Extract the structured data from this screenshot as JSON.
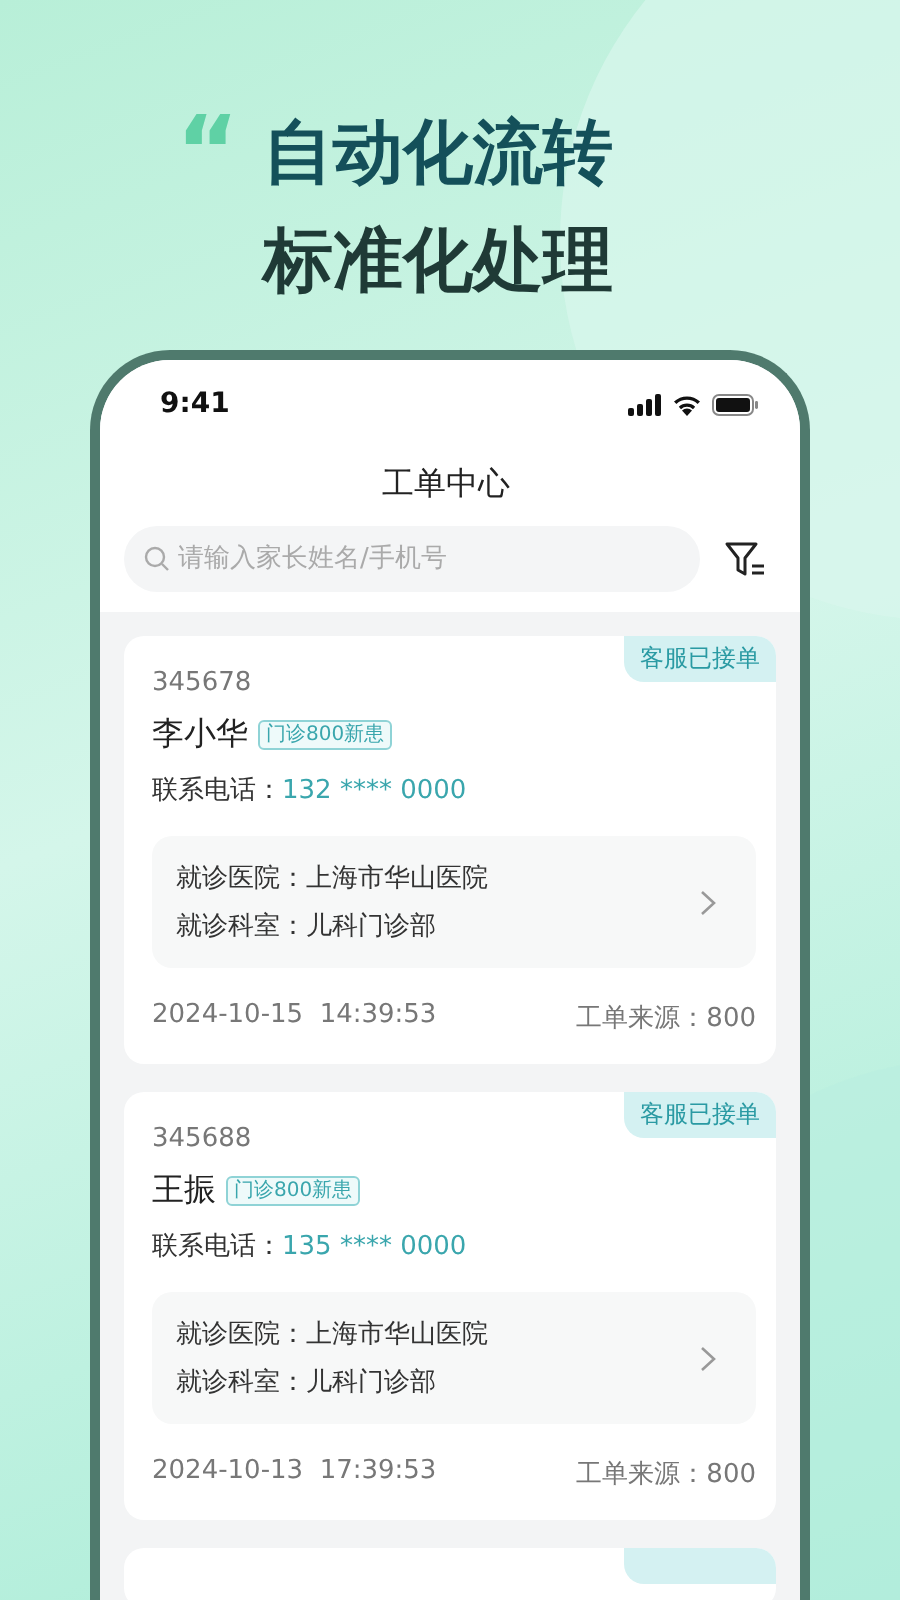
{
  "headline": {
    "quote_mark": "“",
    "lines": [
      "自动化流转",
      "标准化处理"
    ]
  },
  "status_bar": {
    "time": "9:41"
  },
  "header": {
    "title": "工单中心"
  },
  "search": {
    "placeholder": "请输入家长姓名/手机号"
  },
  "orders": [
    {
      "status": "客服已接单",
      "number": "345678",
      "name": "李小华",
      "tag": "门诊800新患",
      "phone_label": "联系电话：",
      "phone": "132 **** 0000",
      "hospital": "就诊医院：上海市华山医院",
      "department": "就诊科室：儿科门诊部",
      "time": "2024-10-15  14:39:53",
      "source": "工单来源：800"
    },
    {
      "status": "客服已接单",
      "number": "345688",
      "name": "王振",
      "tag": "门诊800新患",
      "phone_label": "联系电话：",
      "phone": "135 **** 0000",
      "hospital": "就诊医院：上海市华山医院",
      "department": "就诊科室：儿科门诊部",
      "time": "2024-10-13  17:39:53",
      "source": "工单来源：800"
    }
  ]
}
